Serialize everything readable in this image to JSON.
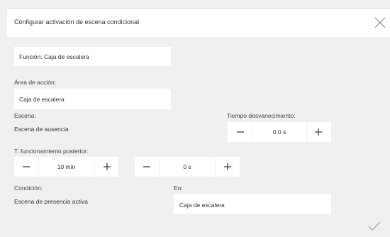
{
  "dialog": {
    "title": "Configurar activación de escena condicional"
  },
  "function_field": {
    "value": "Función: Caja de escalera"
  },
  "action_area": {
    "label": "Área de acción:",
    "value": "Caja de escalera"
  },
  "scene": {
    "label": "Escena:",
    "value": "Escena de ausencia"
  },
  "fade_time": {
    "label": "Tiempo desvanecimiento:",
    "value": "0.0 s"
  },
  "post_time": {
    "label": "T. funcionamiento posterior:",
    "minutes_value": "10 min",
    "seconds_value": "0 s"
  },
  "condition": {
    "label": "Condición:",
    "value": "Escena de presencia activa"
  },
  "in_field": {
    "label": "En:",
    "value": "Caja de escalera"
  },
  "icons": {
    "close": "close-icon",
    "minus": "minus-icon",
    "plus": "plus-icon",
    "confirm": "checkmark-icon"
  }
}
